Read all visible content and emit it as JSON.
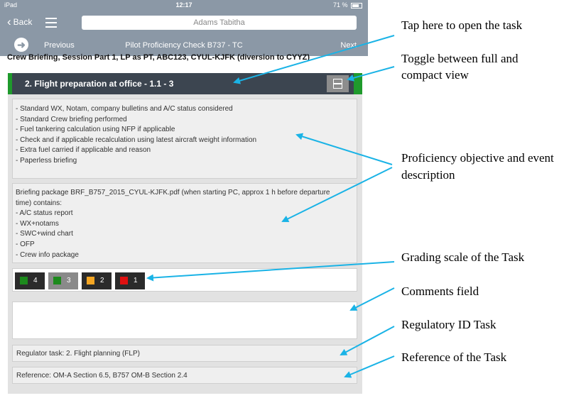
{
  "status_bar": {
    "device": "iPad",
    "time": "12:17",
    "battery": "71 %"
  },
  "nav": {
    "back_label": "Back",
    "user_name": "Adams Tabitha"
  },
  "title_bar": {
    "previous_label": "Previous",
    "title": "Pilot Proficiency Check B737 - TC",
    "next_label": "Next"
  },
  "session_line": "Crew Briefing, Session Part 1, LP as PT, ABC123, CYUL-KJFK (diversion to CYYZ)",
  "task": {
    "title": "2.  Flight preparation at office  - 1.1 - 3",
    "objective_lines": [
      "- Standard WX, Notam, company bulletins and A/C status considered",
      "- Standard Crew briefing performed",
      "- Fuel tankering calculation using NFP if applicable",
      "- Check and if applicable recalculation using latest aircraft weight information",
      "- Extra fuel carried if applicable and reason",
      "- Paperless briefing"
    ],
    "briefing_lines": [
      "Briefing package BRF_B757_2015_CYUL-KJFK.pdf (when starting PC, approx 1 h before departure",
      "time) contains:",
      "- A/C status report",
      "- WX+notams",
      "- SWC+wind chart",
      "- OFP",
      "- Crew info package"
    ],
    "grades": [
      {
        "label": "4",
        "color": "#1c8a1c",
        "bg": "#2b2b2b"
      },
      {
        "label": "3",
        "color": "#1c8a1c",
        "bg": "#8a8a8a"
      },
      {
        "label": "2",
        "color": "#f5a623",
        "bg": "#2b2b2b"
      },
      {
        "label": "1",
        "color": "#e01010",
        "bg": "#2b2b2b"
      }
    ],
    "regulator": "Regulator task: 2. Flight planning (FLP)",
    "reference": "Reference: OM-A Section 6.5, B757 OM-B Section 2.4"
  },
  "callouts": {
    "open_task": "Tap here to open the task",
    "toggle_line1": "Toggle between full and",
    "toggle_line2": "compact view",
    "objective_line1": "Proficiency objective and event",
    "objective_line2": "description",
    "grading": "Grading scale of the Task",
    "comments": "Comments field",
    "regulatory": "Regulatory ID Task",
    "reference": "Reference of the Task"
  },
  "colors": {
    "accent_arrow": "#1ab3e6",
    "header": "#3c4550",
    "nav": "#8b98a6",
    "task_green": "#1f9a2c"
  }
}
